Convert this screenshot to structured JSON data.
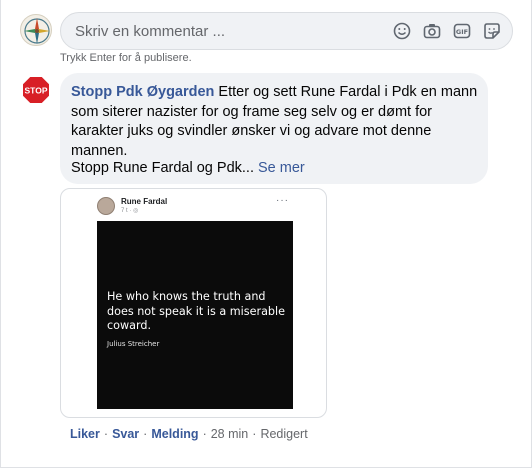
{
  "composer": {
    "placeholder": "Skriv en kommentar ...",
    "hint": "Trykk Enter for å publisere.",
    "icons": [
      "emoji-icon",
      "camera-icon",
      "gif-icon",
      "sticker-icon"
    ]
  },
  "comment": {
    "author": "Stopp Pdk Øygarden",
    "avatar_text": "STOP",
    "text": "Etter og sett Rune Fardal i Pdk en mann som siterer nazister for og frame seg selv og er dømt for karakter juks og svindler ønsker vi og advare mot denne mannen.",
    "text2": "Stopp Rune Fardal og Pdk...",
    "see_more": "Se mer"
  },
  "shared_image": {
    "author": "Rune Fardal",
    "meta": "7 t · ◎",
    "dots": "···",
    "quote": "He who knows the truth and does not speak it is a miserable coward.",
    "quote_author": "Julius Streicher"
  },
  "actions": {
    "like": "Liker",
    "reply": "Svar",
    "message": "Melding",
    "time": "28 min",
    "edited": "Redigert"
  },
  "colors": {
    "link": "#385898",
    "bubble": "#f0f2f5",
    "stop_red": "#d81f26"
  }
}
